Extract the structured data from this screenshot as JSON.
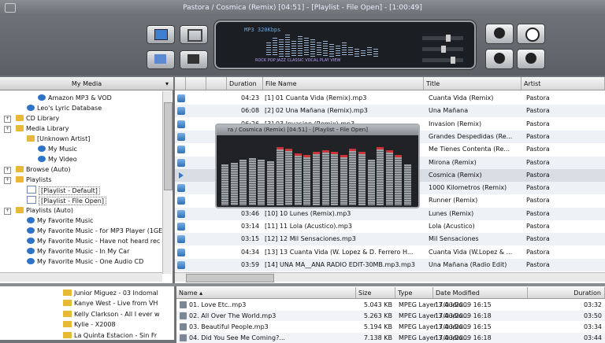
{
  "window": {
    "title": "Pastora / Cosmica (Remix) [04:51] - [Playlist - File Open] - [1:00:49]"
  },
  "player": {
    "display_text": "MP3 320Kbps",
    "eq_labels": "ROCK  POP  JAZZ  CLASSIC  VOCAL  PLAY  VIEW"
  },
  "left_panel": {
    "header": "My Media",
    "tree": [
      {
        "label": "Amazon MP3 & VOD",
        "icon": "globe-icon",
        "indent": 3
      },
      {
        "label": "Leo's Lyric Database",
        "icon": "globe-icon",
        "indent": 2
      },
      {
        "label": "CD Library",
        "icon": "folder-icon",
        "indent": 1
      },
      {
        "label": "Media Library",
        "icon": "folder-icon",
        "indent": 1
      },
      {
        "label": "[Unknown Artist]",
        "icon": "folder-icon",
        "indent": 2
      },
      {
        "label": "My Music",
        "icon": "media-icon",
        "indent": 3
      },
      {
        "label": "My Video",
        "icon": "media-icon",
        "indent": 3
      },
      {
        "label": "Browse (Auto)",
        "icon": "folder-icon",
        "indent": 1
      },
      {
        "label": "Playlists",
        "icon": "folder-icon",
        "indent": 1
      },
      {
        "label": "[Playlist - Default]",
        "icon": "playlist-icon",
        "indent": 2
      },
      {
        "label": "[Playlist - File Open]",
        "icon": "playlist-icon",
        "indent": 2
      },
      {
        "label": "Playlists (Auto)",
        "icon": "folder-icon",
        "indent": 1
      },
      {
        "label": "My Favorite Music",
        "icon": "media-icon",
        "indent": 2
      },
      {
        "label": "My Favorite Music - for MP3 Player (1GE",
        "icon": "media-icon",
        "indent": 2
      },
      {
        "label": "My Favorite Music - Have not heard rec",
        "icon": "media-icon",
        "indent": 2
      },
      {
        "label": "My Favorite Music - In My Car",
        "icon": "media-icon",
        "indent": 2
      },
      {
        "label": "My Favorite Music - One Audio CD",
        "icon": "media-icon",
        "indent": 2
      }
    ]
  },
  "playlist": {
    "columns": [
      "Duration",
      "File Name",
      "Title",
      "Artist"
    ],
    "rows": [
      {
        "duration": "04:23",
        "file": "[1] 01 Cuanta Vida (Remix).mp3",
        "title": "Cuanta Vida (Remix)",
        "artist": "Pastora"
      },
      {
        "duration": "06:08",
        "file": "[2] 02 Una Mañana (Remix).mp3",
        "title": "Una Mañana",
        "artist": "Pastora"
      },
      {
        "duration": "06:26",
        "file": "[3] 03 Invasion (Remix).mp3",
        "title": "Invasion (Remix)",
        "artist": "Pastora"
      },
      {
        "duration": "",
        "file": "",
        "title": "Grandes Despedidas (Re...",
        "artist": "Pastora"
      },
      {
        "duration": "",
        "file": "",
        "title": "Me Tienes Contenta (Re...",
        "artist": "Pastora"
      },
      {
        "duration": "",
        "file": "",
        "title": "Mirona (Remix)",
        "artist": "Pastora"
      },
      {
        "duration": "",
        "file": "",
        "title": "Cosmica (Remix)",
        "artist": "Pastora"
      },
      {
        "duration": "",
        "file": "",
        "title": "1000 Kilometros (Remix)",
        "artist": "Pastora"
      },
      {
        "duration": "",
        "file": "",
        "title": "Runner (Remix)",
        "artist": "Pastora"
      },
      {
        "duration": "03:46",
        "file": "[10] 10 Lunes (Remix).mp3",
        "title": "Lunes (Remix)",
        "artist": "Pastora"
      },
      {
        "duration": "03:14",
        "file": "[11] 11 Lola (Acustico).mp3",
        "title": "Lola (Acustico)",
        "artist": "Pastora"
      },
      {
        "duration": "03:15",
        "file": "[12] 12 Mil Sensaciones.mp3",
        "title": "Mil Sensaciones",
        "artist": "Pastora"
      },
      {
        "duration": "04:34",
        "file": "[13] 13 Cuanta Vida (W. Lopez & D. Ferrero H...",
        "title": "Cuanta Vida (W.Lopez & ...",
        "artist": "Pastora"
      },
      {
        "duration": "03:59",
        "file": "[14] UNA MA__ANA RADIO EDIT-30MB.mp3.mp3",
        "title": "Una Mañana (Radio Edit)",
        "artist": "Pastora"
      }
    ]
  },
  "mini_player": {
    "title": "ra / Cosmica (Remix) [04:51] - [Playlist - File Open]"
  },
  "folder_tree": [
    {
      "label": "Junior Miguez - 03 Indomal"
    },
    {
      "label": "Kanye West - Live from VH"
    },
    {
      "label": "Kelly Clarkson - All I ever w"
    },
    {
      "label": "Kylie - X2008"
    },
    {
      "label": "La Quinta Estacion - Sin Fr"
    }
  ],
  "files": {
    "columns": [
      "Name",
      "Size",
      "Type",
      "Date Modified",
      "Duration"
    ],
    "rows": [
      {
        "name": "01. Love Etc..mp3",
        "size": "5.043 KB",
        "type": "MPEG Layer 3 Audio...",
        "date": "17/03/2009 16:15",
        "duration": "03:32"
      },
      {
        "name": "02. All Over The World.mp3",
        "size": "5.263 KB",
        "type": "MPEG Layer 3 Audio...",
        "date": "17/03/2009 16:18",
        "duration": "03:50"
      },
      {
        "name": "03. Beautiful People.mp3",
        "size": "5.194 KB",
        "type": "MPEG Layer 3 Audio...",
        "date": "17/03/2009 16:15",
        "duration": "03:34"
      },
      {
        "name": "04. Did You See Me Coming?...",
        "size": "7.138 KB",
        "type": "MPEG Layer 3 Audio...",
        "date": "17/03/2009 16:18",
        "duration": "03:44"
      }
    ]
  }
}
